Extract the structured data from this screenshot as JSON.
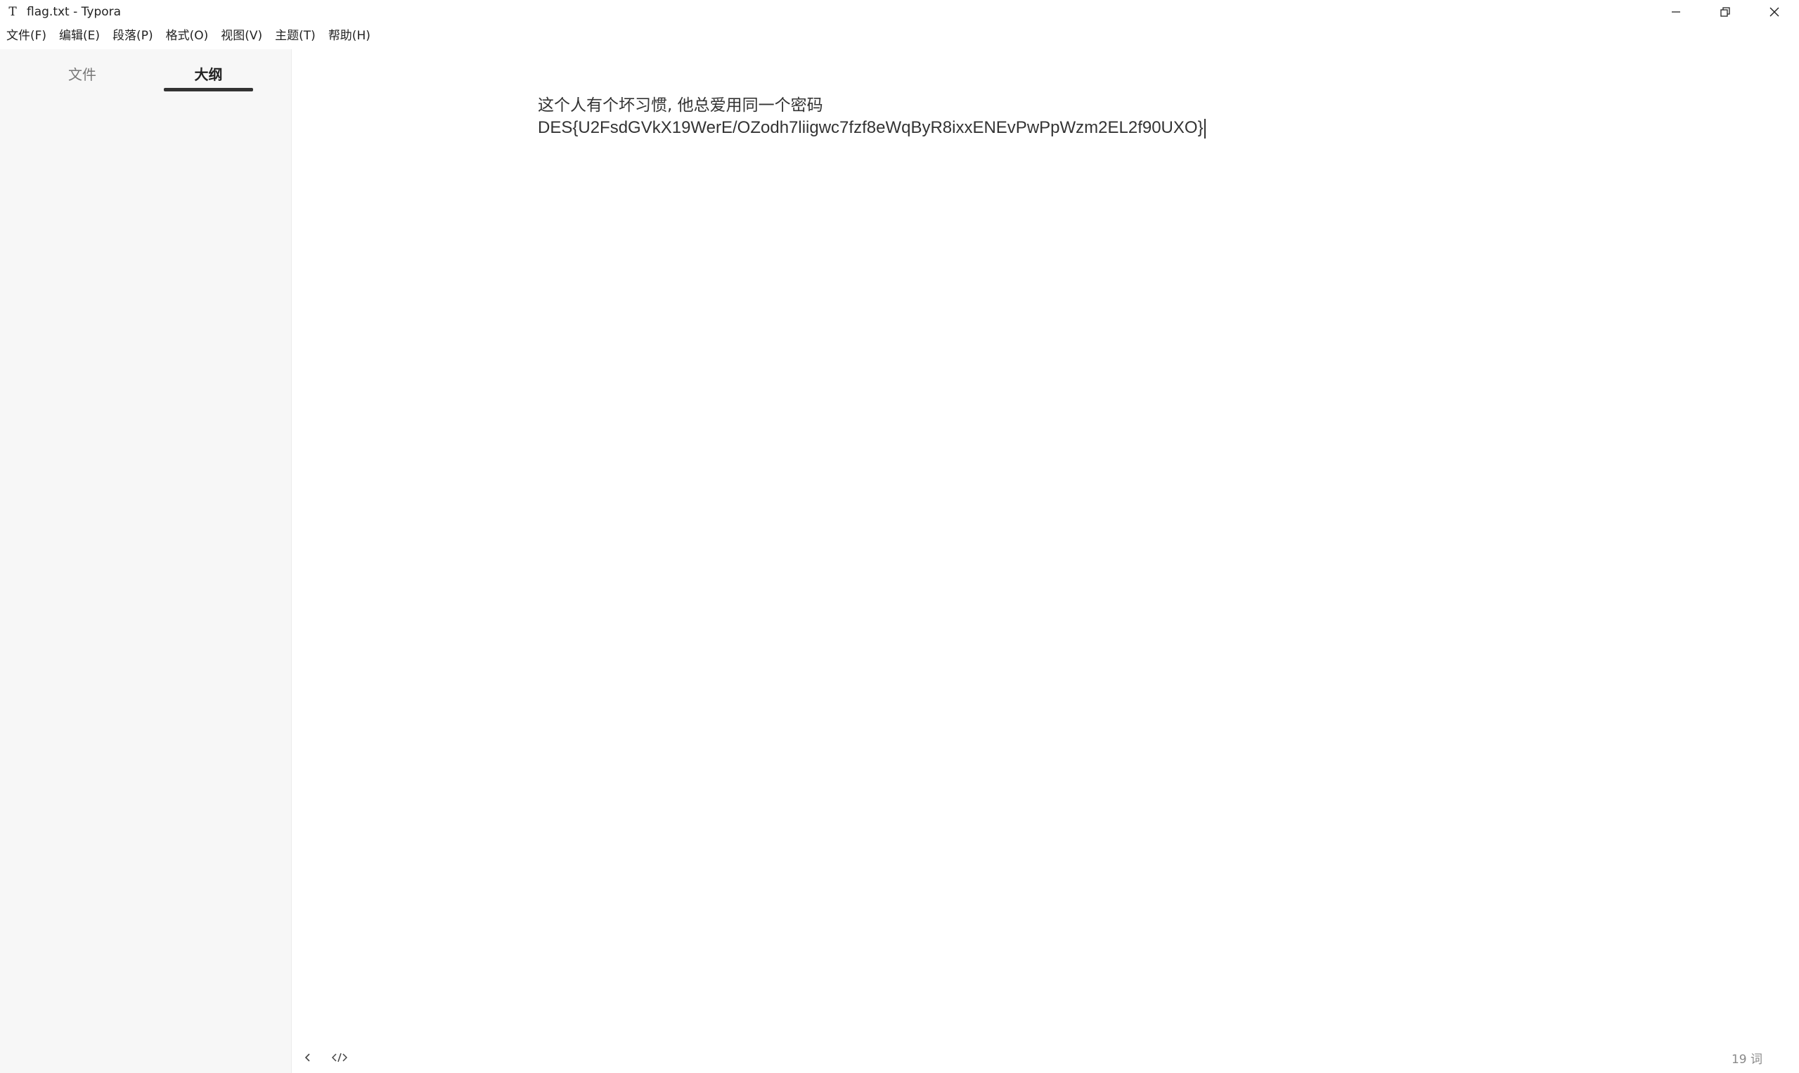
{
  "window": {
    "app_icon_glyph": "T",
    "title": "flag.txt - Typora",
    "controls": [
      "minimize-icon",
      "restore-icon",
      "close-icon"
    ]
  },
  "menubar": {
    "items": [
      "文件(F)",
      "编辑(E)",
      "段落(P)",
      "格式(O)",
      "视图(V)",
      "主题(T)",
      "帮助(H)"
    ]
  },
  "sidebar": {
    "tabs": [
      {
        "label": "文件",
        "active": false
      },
      {
        "label": "大纲",
        "active": true
      }
    ]
  },
  "document": {
    "lines": [
      "这个人有个坏习惯, 他总爱用同一个密码",
      "DES{U2FsdGVkX19WerE/OZodh7liigwc7fzf8eWqByR8ixxENEvPwPpWzm2EL2f90UXO}"
    ]
  },
  "footer": {
    "back_icon": "chevron-left-icon",
    "source_icon": "source-code-icon",
    "word_count": "19 词"
  }
}
